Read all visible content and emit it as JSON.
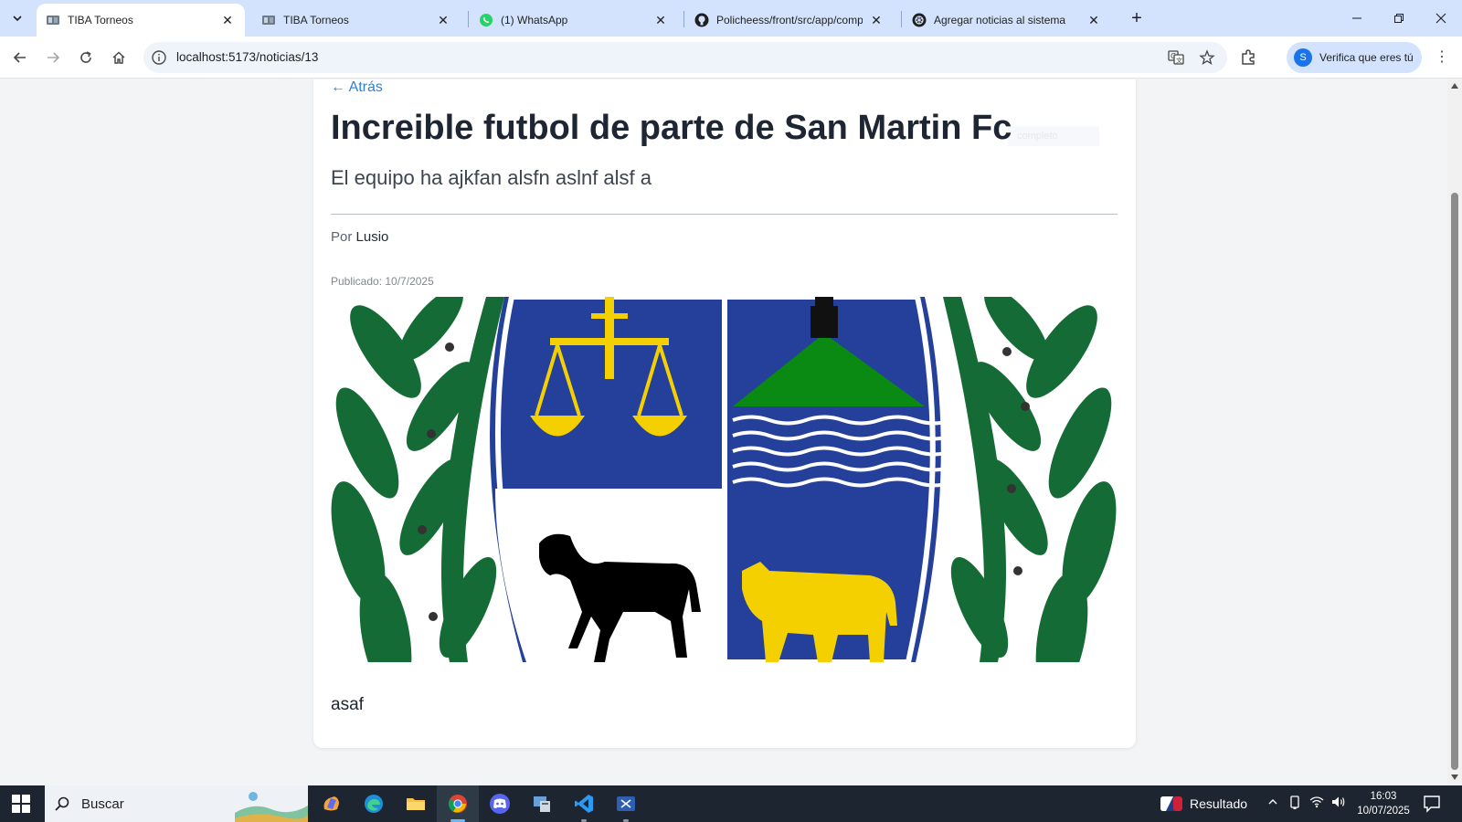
{
  "browser": {
    "tabs": [
      {
        "title": "TIBA Torneos",
        "favicon": "tiba-favicon-icon",
        "active": true
      },
      {
        "title": "TIBA Torneos",
        "favicon": "tiba-favicon-icon",
        "active": false
      },
      {
        "title": "(1) WhatsApp",
        "favicon": "whatsapp-icon",
        "active": false
      },
      {
        "title": "Policheess/front/src/app/compo",
        "favicon": "github-icon",
        "active": false
      },
      {
        "title": "Agregar noticias al sistema",
        "favicon": "openai-icon",
        "active": false
      }
    ],
    "url": "localhost:5173/noticias/13",
    "profile_label": "Verifica que eres tú",
    "profile_initial": "S"
  },
  "article": {
    "back_link": "← Atrás",
    "title": "Increible futbol de parte de San Martin Fc",
    "faint_overlay": "completo",
    "subtitle": "El equipo ha ajkfan alsfn aslnf alsf a",
    "byline_prefix": "Por",
    "author": "Lusio",
    "published": "Publicado: 10/7/2025",
    "image": "provincial-coat-of-arms",
    "body": "asaf"
  },
  "taskbar": {
    "search_placeholder": "Buscar",
    "result_label": "Resultado",
    "time": "16:03",
    "date": "10/07/2025"
  },
  "colors": {
    "tabstrip": "#d3e3fd",
    "link": "#2f80d6",
    "shield_blue": "#24409a",
    "laurel_green": "#156b35",
    "scale_yellow": "#f5d000",
    "taskbar": "#1c2530"
  }
}
